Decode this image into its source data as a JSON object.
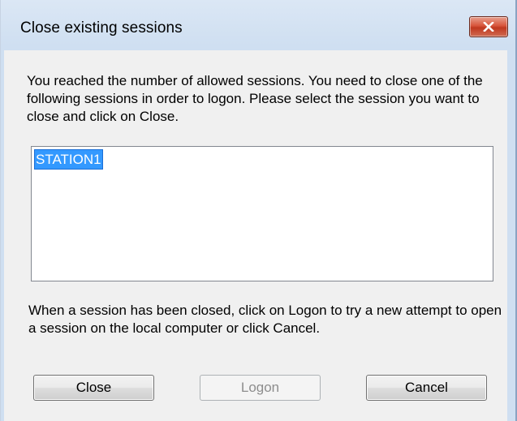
{
  "dialog": {
    "title": "Close existing sessions",
    "message": "You reached the number of allowed sessions. You need to close one of the following sessions in order to logon. Please select the session you want to close and click on Close.",
    "sessions": [
      "STATION1"
    ],
    "selected_session": "STATION1",
    "hint": "When a session has been closed, click on Logon to try a new attempt to open a session on the local computer or click Cancel."
  },
  "buttons": {
    "close": "Close",
    "logon": "Logon",
    "cancel": "Cancel"
  },
  "colors": {
    "selection": "#3399ff",
    "title_close_button": "#c7442a",
    "disabled_text": "#8d8d8d"
  }
}
